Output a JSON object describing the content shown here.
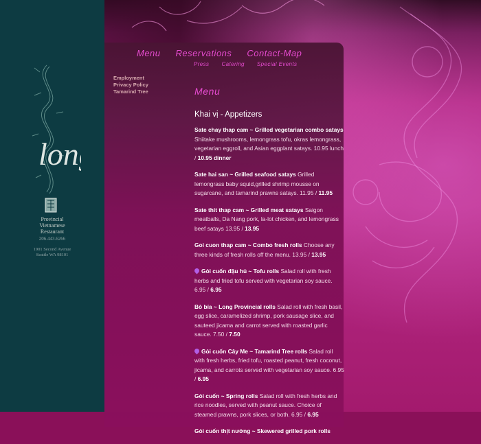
{
  "brand": {
    "logo_text": "long",
    "subtitle_lines": [
      "Provincial",
      "Vietnamese",
      "Restaurant"
    ],
    "phone": "206.443.6266",
    "address_lines": [
      "1901 Second Avenue",
      "Seattle WA 98101"
    ]
  },
  "nav": {
    "main": [
      "Menu",
      "Reservations",
      "Contact-Map"
    ],
    "sub": [
      "Press",
      "Catering",
      "Special Events"
    ]
  },
  "side_links": [
    "Employment",
    "Privacy Policy",
    "Tamarind Tree"
  ],
  "page": {
    "title": "Menu",
    "section_heading": "Khai vị - Appetizers"
  },
  "menu_items": [
    {
      "name": "Sate chay thap cam ~ Grilled vegetarian combo satays",
      "desc": " Shiitake mushrooms, lemongrass tofu, okras lemongrass, vegetarian eggroll, and Asian eggplant satays. 10.95 lunch / ",
      "price2": "10.95 dinner",
      "veg": false
    },
    {
      "name": "Sate hai san ~ Grilled seafood satays",
      "desc": " Grilled lemongrass baby squid,grilled shrimp mousse on sugarcane, and tamarind prawns satays. 11.95 / ",
      "price2": "11.95",
      "veg": false
    },
    {
      "name": "Sate thit thap cam ~ Grilled meat satays",
      "desc": " Saigon meatballs, Da Nang pork, la-lot chicken, and lemongrass beef satays 13.95 / ",
      "price2": "13.95",
      "veg": false
    },
    {
      "name": "Goi cuon thap cam ~ Combo fresh rolls",
      "desc": " Choose any three kinds of fresh rolls off the menu. 13.95 / ",
      "price2": "13.95",
      "veg": false
    },
    {
      "name": "Gỏi cuốn đậu hủ ~ Tofu rolls",
      "desc": " Salad roll with fresh herbs and fried tofu served with vegetarian soy sauce. 6.95 / ",
      "price2": "6.95",
      "veg": true
    },
    {
      "name": "Bò bía ~ Long Provincial rolls",
      "desc": " Salad roll with fresh basil, egg slice, caramelized shrimp, pork sausage slice, and sauteed jicama and carrot served with roasted garlic sauce. 7.50 / ",
      "price2": "7.50",
      "veg": false
    },
    {
      "name": "Gỏi cuốn Cây Me ~ Tamarind Tree rolls",
      "desc": " Salad roll with fresh herbs, fried tofu, roasted peanut, fresh coconut, jicama, and carrots served with vegetarian soy sauce. 6.95 / ",
      "price2": "6.95",
      "veg": true
    },
    {
      "name": "Gỏi cuốn ~ Spring rolls",
      "desc": " Salad roll with fresh herbs and rice noodles, served with peanut sauce. Choice of steamed prawns, pork slices, or both. 6.95 / ",
      "price2": "6.95",
      "veg": false
    },
    {
      "name": "Gỏi cuốn thịt nướng ~ Skewered grilled pork rolls",
      "desc": "",
      "price2": "",
      "veg": false
    }
  ]
}
